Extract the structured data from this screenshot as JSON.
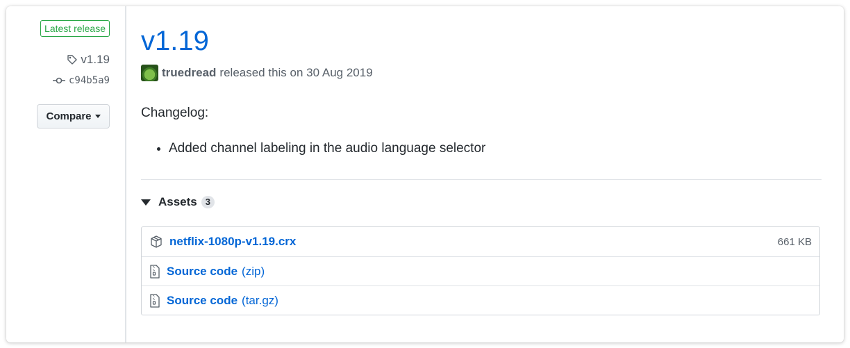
{
  "sidebar": {
    "badge": "Latest release",
    "tag": "v1.19",
    "commit": "c94b5a9",
    "compare_label": "Compare"
  },
  "release": {
    "title": "v1.19",
    "author": "truedread",
    "released_text": "released this on 30 Aug 2019",
    "changelog_title": "Changelog:",
    "changelog_items": [
      "Added channel labeling in the audio language selector"
    ]
  },
  "assets": {
    "label": "Assets",
    "count": "3",
    "items": [
      {
        "name": "netflix-1080p-v1.19.crx",
        "suffix": "",
        "size": "661 KB",
        "icon": "package-icon"
      },
      {
        "name": "Source code",
        "suffix": "(zip)",
        "size": "",
        "icon": "file-zip-icon"
      },
      {
        "name": "Source code",
        "suffix": "(tar.gz)",
        "size": "",
        "icon": "file-zip-icon"
      }
    ]
  },
  "colors": {
    "link": "#0366d6",
    "badge_green": "#28a745",
    "muted": "#586069",
    "border": "#e1e4e8"
  }
}
